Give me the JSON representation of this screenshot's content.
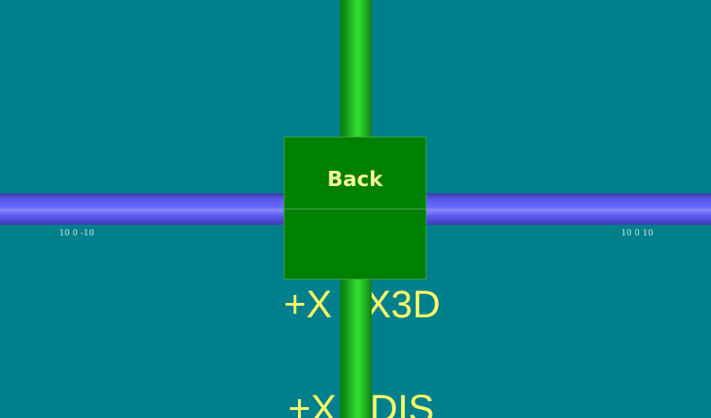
{
  "scene": {
    "background_color": "#00808c",
    "x_axis_color": "#6a6aff",
    "y_axis_color": "#2bd42b"
  },
  "back_panel": {
    "label": "Back",
    "color": "#008000",
    "label_color": "#f4f498"
  },
  "tick_labels": {
    "left": "10 0 -10",
    "right": "10 0 10"
  },
  "scene_labels": [
    {
      "text": "+X +X3D"
    },
    {
      "text": "+X +DIS"
    }
  ]
}
